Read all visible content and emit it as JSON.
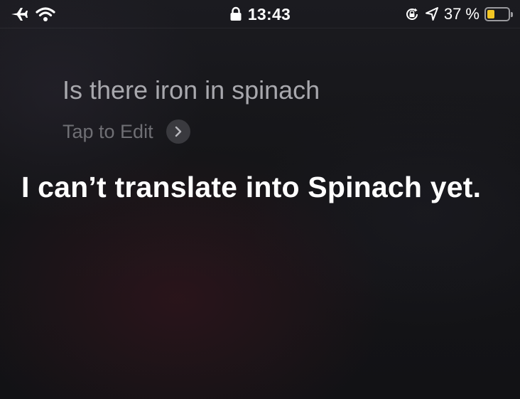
{
  "status_bar": {
    "time": "13:43",
    "battery_percent": "37 %",
    "battery_level": 0.37,
    "icons": [
      "airplane-icon",
      "wifi-icon",
      "lock-icon",
      "orientation-lock-icon",
      "location-icon",
      "battery-icon"
    ],
    "battery_color": "#f3c623"
  },
  "siri": {
    "query": "Is there iron in spinach",
    "tap_to_edit": "Tap to Edit",
    "response": "I can’t translate into Spinach yet."
  },
  "colors": {
    "query_text": "#a8a8ad",
    "secondary_text": "#6f6f74",
    "response_text": "#ffffff"
  }
}
